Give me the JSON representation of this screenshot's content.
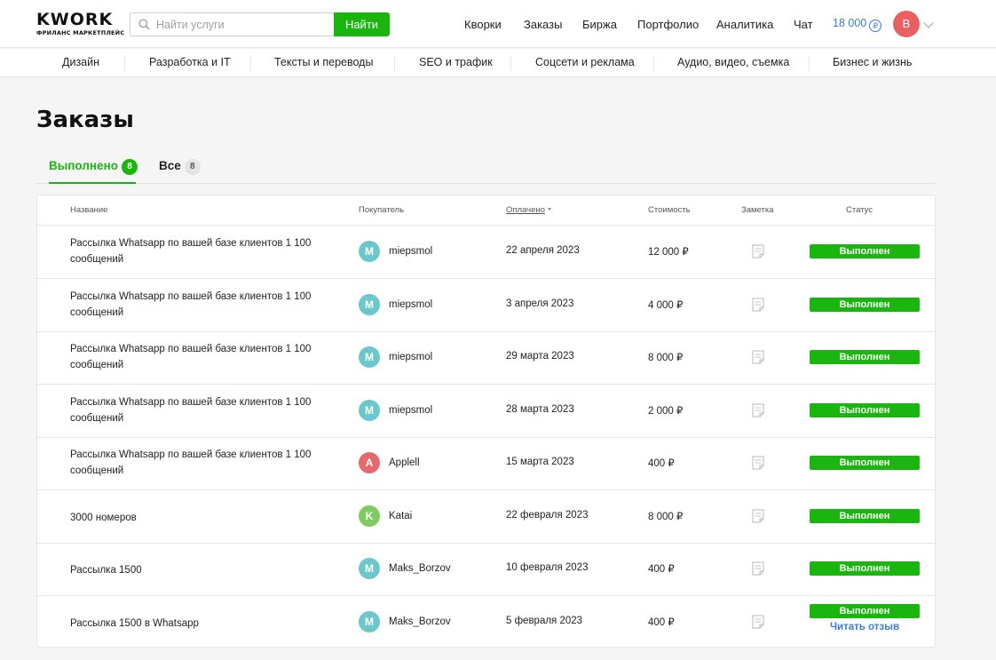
{
  "brand": {
    "name_prefix": "K",
    "name_rest": "WORK",
    "subtitle": "ФРИЛАНС МАРКЕТПЛЕЙС"
  },
  "search": {
    "placeholder": "Найти услуги",
    "button": "Найти"
  },
  "topnav": [
    "Кворки",
    "Заказы",
    "Биржа",
    "Портфолио",
    "Аналитика",
    "Чат"
  ],
  "balance": {
    "amount": "18 000",
    "currency_symbol": "₽"
  },
  "user": {
    "initial": "B"
  },
  "categories": [
    "Дизайн",
    "Разработка и IT",
    "Тексты и переводы",
    "SEO и трафик",
    "Соцсети и реклама",
    "Аудио, видео, съемка",
    "Бизнес и жизнь"
  ],
  "page_title": "Заказы",
  "tabs": [
    {
      "label": "Выполнено",
      "count": "8"
    },
    {
      "label": "Все",
      "count": "8"
    }
  ],
  "columns": {
    "name": "Название",
    "buyer": "Покупатель",
    "paid": "Оплачено",
    "price": "Стоимость",
    "note": "Заметка",
    "status": "Статус"
  },
  "colors": {
    "accent": "#1bb50f",
    "link": "#3a7ad5"
  },
  "orders": [
    {
      "name": "Рассылка Whatsapp по вашей базе клиентов 1 100 сообщений",
      "buyer": "miepsmol",
      "buyer_initial": "M",
      "avatar_color": "#6cc7cd",
      "date": "22 апреля 2023",
      "price": "12 000 ₽",
      "status": "Выполнен"
    },
    {
      "name": "Рассылка Whatsapp по вашей базе клиентов 1 100 сообщений",
      "buyer": "miepsmol",
      "buyer_initial": "M",
      "avatar_color": "#6cc7cd",
      "date": "3 апреля 2023",
      "price": "4 000 ₽",
      "status": "Выполнен"
    },
    {
      "name": "Рассылка Whatsapp по вашей базе клиентов 1 100 сообщений",
      "buyer": "miepsmol",
      "buyer_initial": "M",
      "avatar_color": "#6cc7cd",
      "date": "29 марта 2023",
      "price": "8 000 ₽",
      "status": "Выполнен"
    },
    {
      "name": "Рассылка Whatsapp по вашей базе клиентов 1 100 сообщений",
      "buyer": "miepsmol",
      "buyer_initial": "M",
      "avatar_color": "#6cc7cd",
      "date": "28 марта 2023",
      "price": "2 000 ₽",
      "status": "Выполнен"
    },
    {
      "name": "Рассылка Whatsapp по вашей базе клиентов 1 100 сообщений",
      "buyer": "Applell",
      "buyer_initial": "A",
      "avatar_color": "#e36b6e",
      "date": "15 марта 2023",
      "price": "400 ₽",
      "status": "Выполнен"
    },
    {
      "name": "3000 номеров",
      "buyer": "Katai",
      "buyer_initial": "K",
      "avatar_color": "#7ecb5f",
      "date": "22 февраля 2023",
      "price": "8 000 ₽",
      "status": "Выполнен"
    },
    {
      "name": "Рассылка 1500",
      "buyer": "Maks_Borzov",
      "buyer_initial": "M",
      "avatar_color": "#6cc7cd",
      "date": "10 февраля 2023",
      "price": "400 ₽",
      "status": "Выполнен"
    },
    {
      "name": "Рассылка 1500 в Whatsapp",
      "buyer": "Maks_Borzov",
      "buyer_initial": "M",
      "avatar_color": "#6cc7cd",
      "date": "5 февраля 2023",
      "price": "400 ₽",
      "status": "Выполнен",
      "review_link": "Читать отзыв"
    }
  ]
}
